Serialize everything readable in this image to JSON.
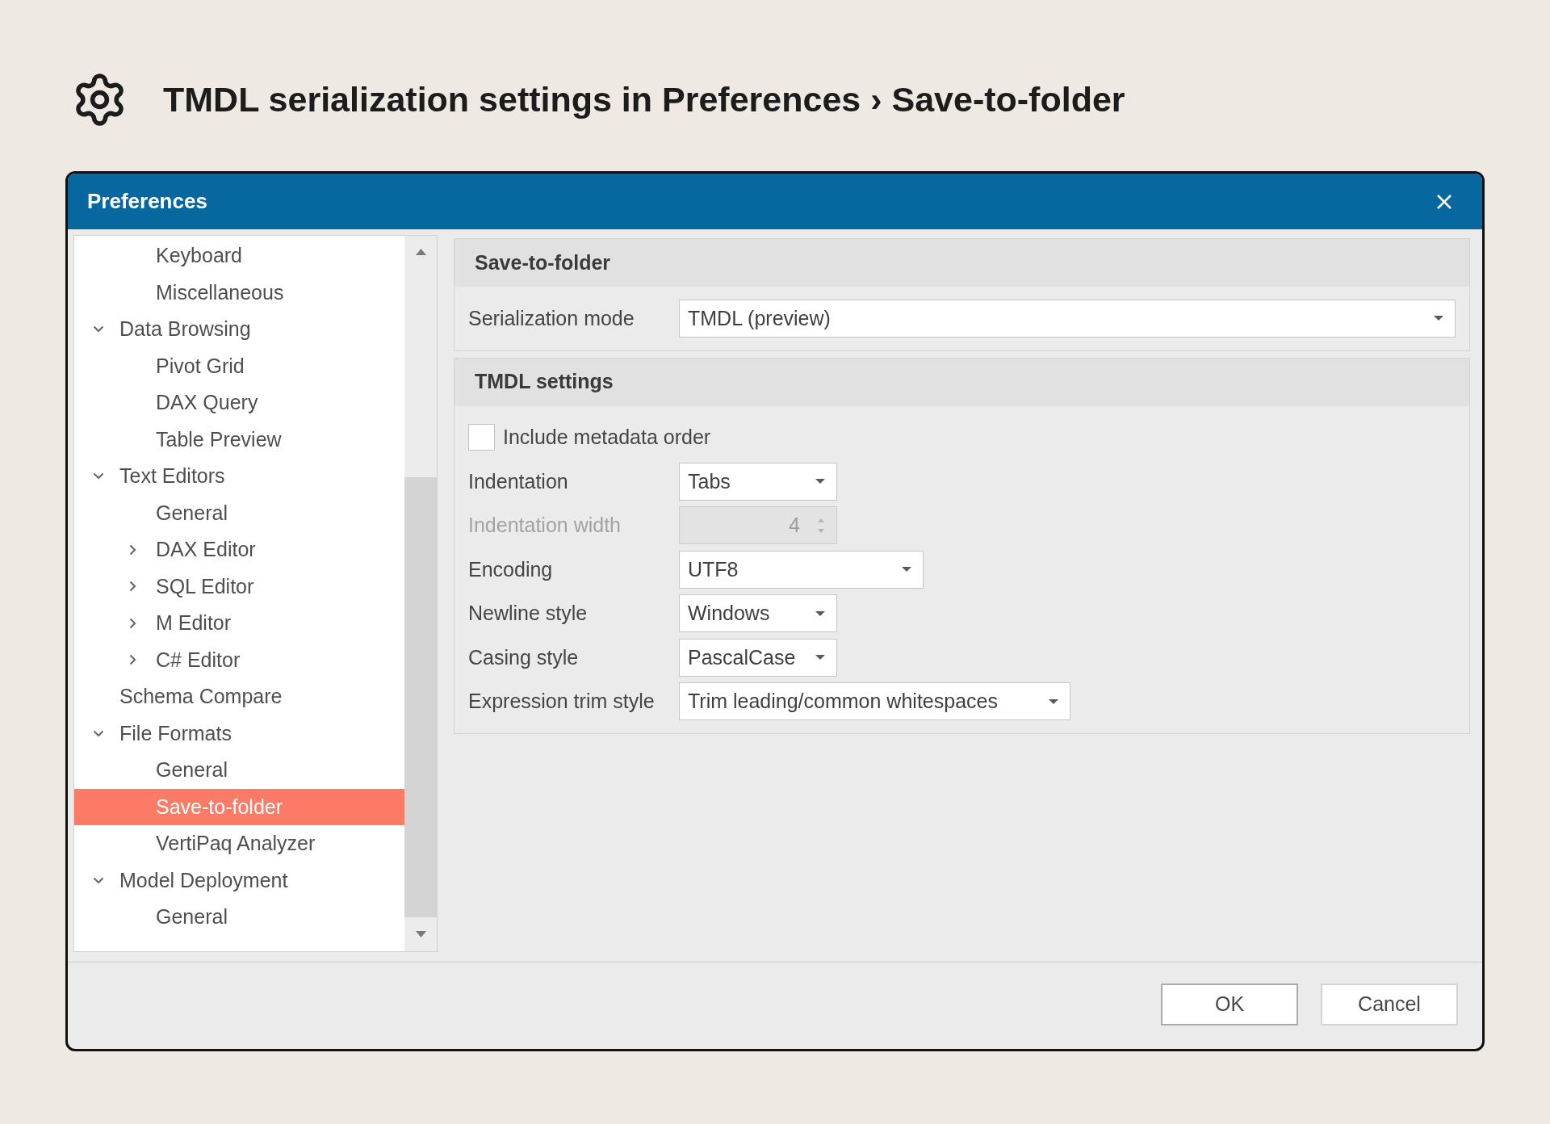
{
  "heading": {
    "title": "TMDL serialization settings in Preferences › Save-to-folder"
  },
  "dialog": {
    "title": "Preferences",
    "tree": [
      {
        "children": [
          {
            "label": "Keyboard",
            "selected": false
          },
          {
            "label": "Miscellaneous",
            "selected": false
          }
        ]
      },
      {
        "label": "Data Browsing",
        "selected": false,
        "expanded": true,
        "children": [
          {
            "label": "Pivot Grid",
            "selected": false
          },
          {
            "label": "DAX Query",
            "selected": false
          },
          {
            "label": "Table Preview",
            "selected": false
          }
        ]
      },
      {
        "label": "Text Editors",
        "selected": false,
        "expanded": true,
        "children": [
          {
            "label": "General",
            "selected": false
          },
          {
            "label": "DAX Editor",
            "selected": false,
            "expanded": false
          },
          {
            "label": "SQL Editor",
            "selected": false,
            "expanded": false
          },
          {
            "label": "M Editor",
            "selected": false,
            "expanded": false
          },
          {
            "label": "C# Editor",
            "selected": false,
            "expanded": false
          }
        ]
      },
      {
        "label": "Schema Compare",
        "selected": false
      },
      {
        "label": "File Formats",
        "selected": false,
        "expanded": true,
        "children": [
          {
            "label": "General",
            "selected": false
          },
          {
            "label": "Save-to-folder",
            "selected": true
          },
          {
            "label": "VertiPaq Analyzer",
            "selected": false
          }
        ]
      },
      {
        "label": "Model Deployment",
        "selected": false,
        "expanded": true,
        "children": [
          {
            "label": "General",
            "selected": false
          }
        ]
      }
    ],
    "sections": [
      {
        "title": "Save-to-folder",
        "fields": [
          {
            "kind": "dropdown",
            "label": "Serialization mode",
            "value": "TMDL (preview)",
            "disabled": false
          }
        ]
      },
      {
        "title": "TMDL settings",
        "fields": [
          {
            "kind": "checkbox",
            "label": "Include metadata order",
            "checked": false,
            "disabled": false
          },
          {
            "kind": "dropdown",
            "label": "Indentation",
            "value": "Tabs",
            "disabled": false
          },
          {
            "kind": "spinner",
            "label": "Indentation width",
            "value": "4",
            "disabled": true
          },
          {
            "kind": "dropdown",
            "label": "Encoding",
            "value": "UTF8",
            "disabled": false
          },
          {
            "kind": "dropdown",
            "label": "Newline style",
            "value": "Windows",
            "disabled": false
          },
          {
            "kind": "dropdown",
            "label": "Casing style",
            "value": "PascalCase",
            "disabled": false
          },
          {
            "kind": "dropdown",
            "label": "Expression trim style",
            "value": "Trim leading/common whitespaces",
            "disabled": false
          }
        ]
      }
    ],
    "buttons": [
      {
        "label": "OK",
        "default": true
      },
      {
        "label": "Cancel",
        "default": false
      }
    ]
  }
}
